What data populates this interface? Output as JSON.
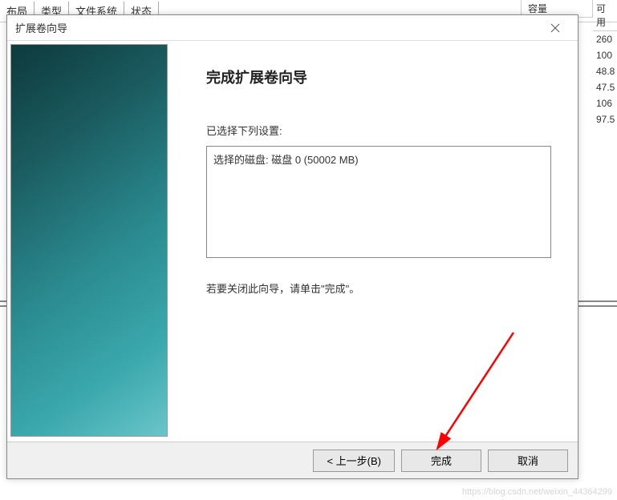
{
  "background": {
    "columns": {
      "layout": "布局",
      "type": "类型",
      "filesystem": "文件系统",
      "status": "状态",
      "capacity": "容量",
      "available": "可用"
    },
    "values": [
      "260",
      "100",
      "48.8",
      "47.5",
      "106",
      "97.5"
    ]
  },
  "dialog": {
    "title": "扩展卷向导",
    "heading": "完成扩展卷向导",
    "selected_label": "已选择下列设置:",
    "settings_text": "选择的磁盘: 磁盘 0 (50002 MB)",
    "instruction": "若要关闭此向导，请单击\"完成\"。",
    "buttons": {
      "back": "< 上一步(B)",
      "finish": "完成",
      "cancel": "取消"
    }
  },
  "watermark": "https://blog.csdn.net/weixin_44364299"
}
